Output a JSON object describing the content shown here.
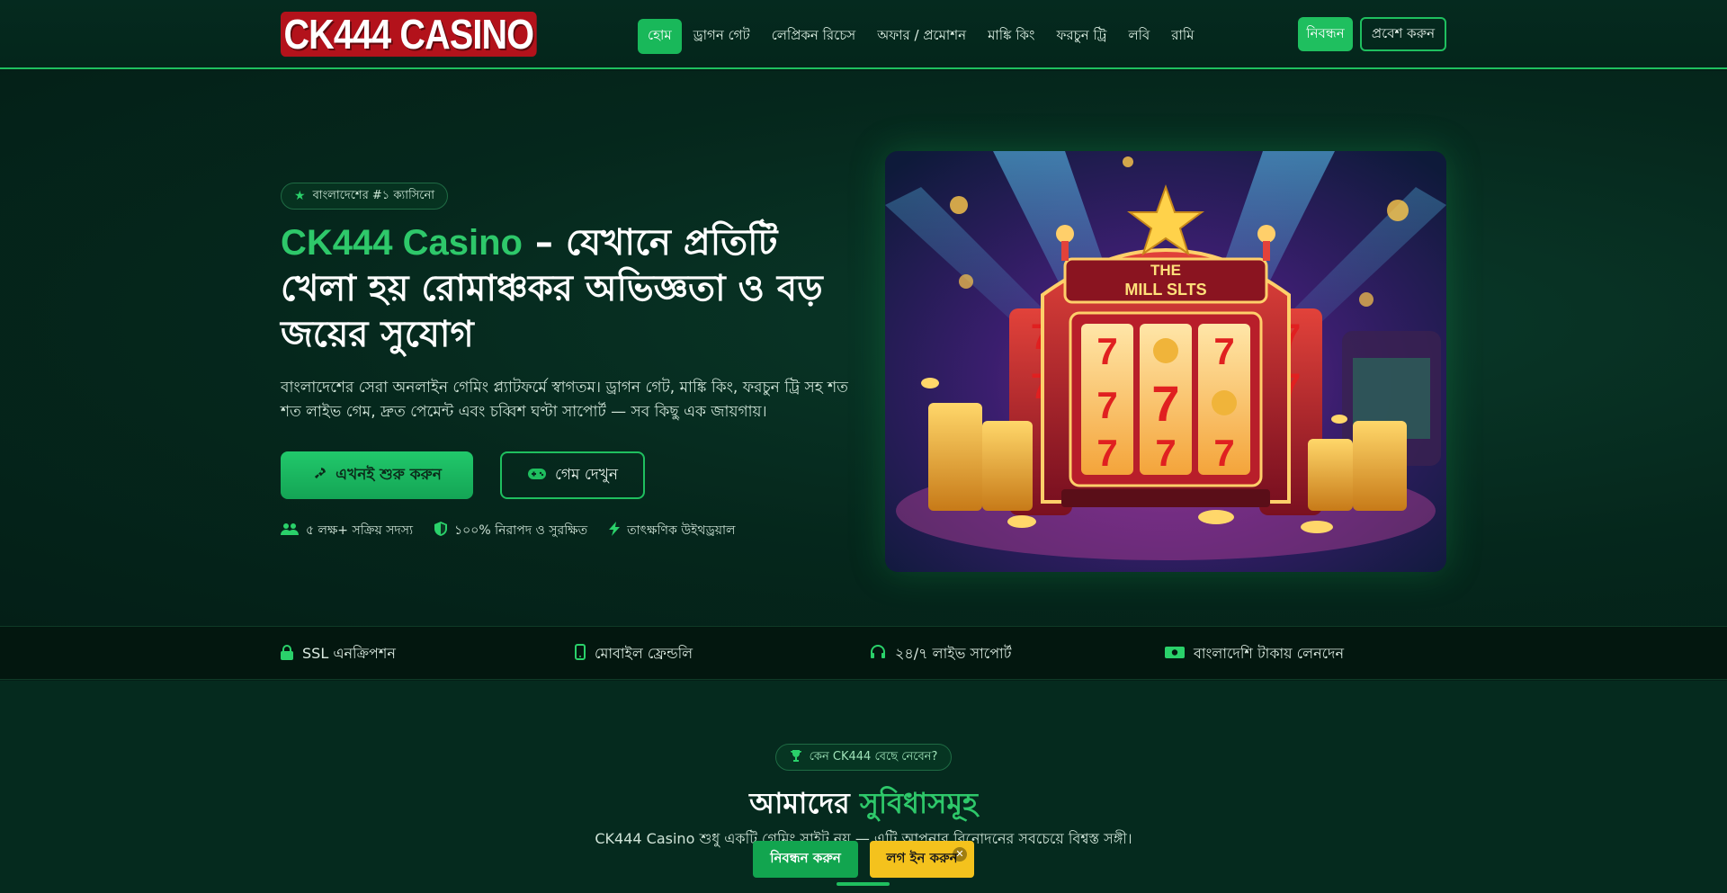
{
  "header": {
    "logo_text": "CK444 CASINO",
    "nav": [
      {
        "label": "হোম",
        "active": true
      },
      {
        "label": "ড্রাগন গেট"
      },
      {
        "label": "লেপ্রিকন রিচেস"
      },
      {
        "label": "অফার / প্রমোশন"
      },
      {
        "label": "মাঙ্কি কিং"
      },
      {
        "label": "ফরচুন ট্রি"
      },
      {
        "label": "লবি"
      },
      {
        "label": "রামি"
      }
    ],
    "register_label": "নিবন্ধন",
    "login_label": "প্রবেশ করুন"
  },
  "hero": {
    "badge": "বাংলাদেশের #১ ক্যাসিনো",
    "title_accent": "CK444 Casino",
    "title_rest": " – যেখানে প্রতিটি খেলা হয় রোমাঞ্চকর অভিজ্ঞতা ও বড় জয়ের সুযোগ",
    "description": "বাংলাদেশের সেরা অনলাইন গেমিং প্ল্যাটফর্মে স্বাগতম। ড্রাগন গেট, মাঙ্কি কিং, ফরচুন ট্রি সহ শত শত লাইভ গেম, দ্রুত পেমেন্ট এবং চব্বিশ ঘণ্টা সাপোর্ট — সব কিছু এক জায়গায়।",
    "cta_primary": "এখনই শুরু করুন",
    "cta_secondary": "গেম দেখুন",
    "stats": [
      {
        "icon": "users-icon",
        "text": "৫ লক্ষ+ সক্রিয় সদস্য"
      },
      {
        "icon": "shield-icon",
        "text": "১০০% নিরাপদ ও সুরক্ষিত"
      },
      {
        "icon": "bolt-icon",
        "text": "তাৎক্ষণিক উইথড্রয়াল"
      }
    ],
    "image_text_top": "THE",
    "image_text_bottom": "MILL SLTS"
  },
  "trust": [
    {
      "icon": "lock-icon",
      "text": "SSL এনক্রিপশন"
    },
    {
      "icon": "mobile-icon",
      "text": "মোবাইল ফ্রেন্ডলি"
    },
    {
      "icon": "headset-icon",
      "text": "২৪/৭ লাইভ সাপোর্ট"
    },
    {
      "icon": "money-icon",
      "text": "বাংলাদেশি টাকায় লেনদেন"
    }
  ],
  "features": {
    "badge": "কেন CK444 বেছে নেবেন?",
    "title_plain": "আমাদের ",
    "title_accent": "সুবিধাসমূহ",
    "description": "CK444 Casino শুধু একটি গেমিং সাইট নয় — এটি আপনার বিনোদনের সবচেয়ে বিশ্বস্ত সঙ্গী।"
  },
  "sticky": {
    "register_label": "নিবন্ধন করুন",
    "login_label": "লগ ইন করুন",
    "close_glyph": "✕"
  },
  "colors": {
    "accent": "#1fbf5f",
    "background": "#041f17",
    "gold": "#f4c21d",
    "logo_red": "#b3121b"
  }
}
